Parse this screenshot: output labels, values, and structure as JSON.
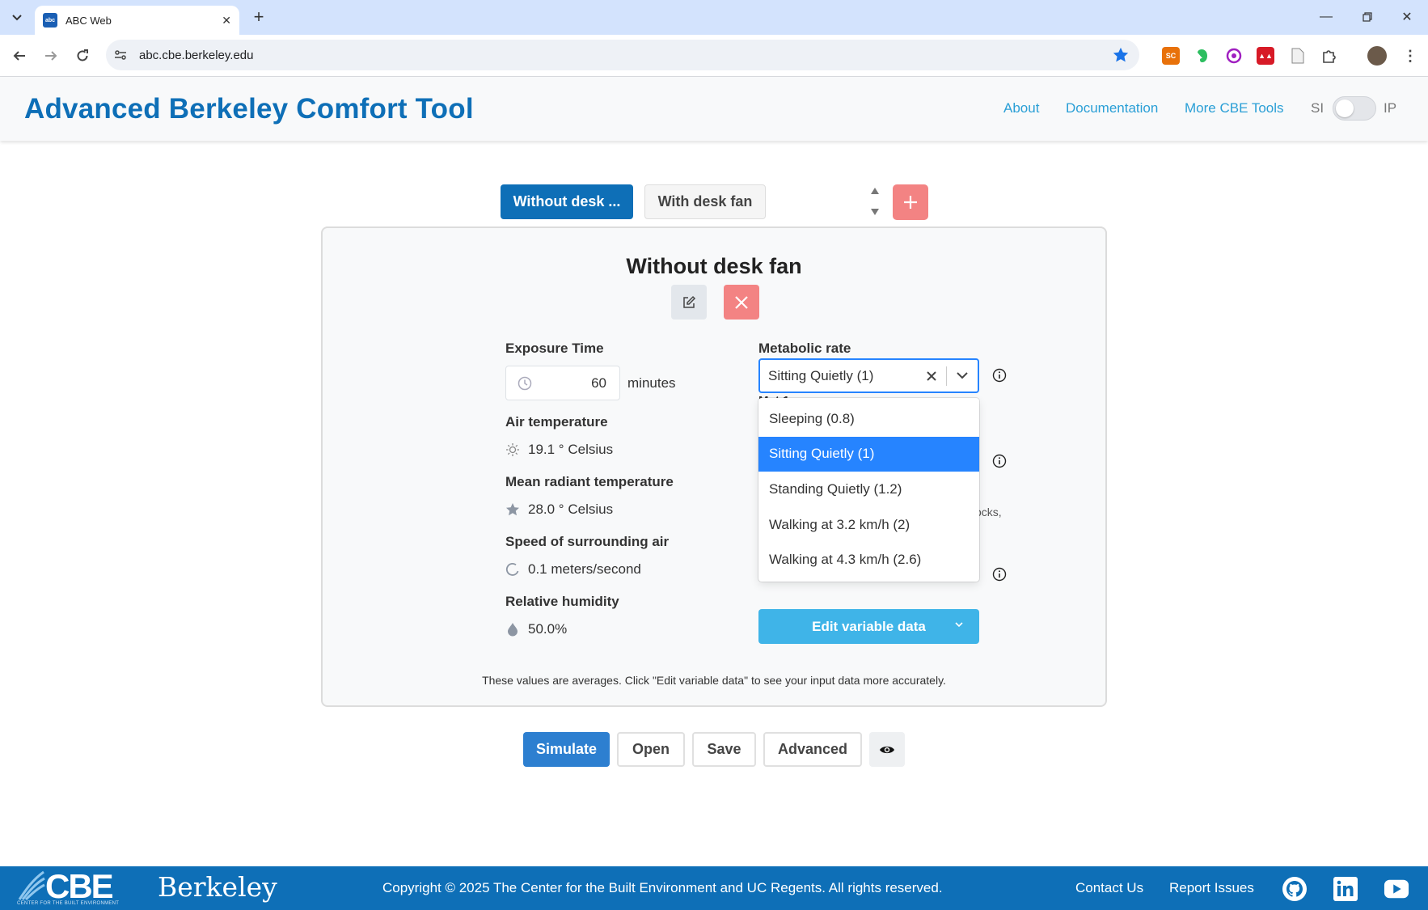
{
  "browser": {
    "tab_title": "ABC Web",
    "favicon_text": "abc",
    "url": "abc.cbe.berkeley.edu"
  },
  "header": {
    "title": "Advanced Berkeley Comfort Tool",
    "nav": [
      "About",
      "Documentation",
      "More CBE Tools"
    ],
    "unit_si": "SI",
    "unit_ip": "IP"
  },
  "scenarios": {
    "tabs": [
      "Without desk ...",
      "With desk fan"
    ]
  },
  "card": {
    "title": "Without desk fan",
    "exposure_label": "Exposure Time",
    "exposure_value": "60",
    "exposure_unit": "minutes",
    "air_temp_label": "Air temperature",
    "air_temp_value": "19.1 ° Celsius",
    "mrt_label": "Mean radiant temperature",
    "mrt_value": "28.0 ° Celsius",
    "air_speed_label": "Speed of surrounding air",
    "air_speed_value": "0.1 meters/second",
    "rh_label": "Relative humidity",
    "rh_value": "50.0%",
    "met_label": "Metabolic rate",
    "met_selected": "Sitting Quietly (1)",
    "met_options": [
      "Sleeping (0.8)",
      "Sitting Quietly (1)",
      "Standing Quietly (1.2)",
      "Walking at 3.2 km/h (2)",
      "Walking at 4.3 km/h (2.6)"
    ],
    "peek_label": "Met 1",
    "socks_fragment": "socks,",
    "edit_var_label": "Edit variable data",
    "note": "These values are averages. Click \"Edit variable data\" to see your input data more accurately."
  },
  "actions": [
    "Simulate",
    "Open",
    "Save",
    "Advanced"
  ],
  "footer": {
    "cbe": "CBE",
    "cbe_sub": "CENTER FOR THE BUILT ENVIRONMENT",
    "berkeley": "Berkeley",
    "copyright": "Copyright © 2025 The Center for the Built Environment and UC Regents. All rights reserved.",
    "links": [
      "Contact Us",
      "Report Issues"
    ]
  },
  "colors": {
    "brand_blue": "#0e6fb7",
    "link_blue": "#2a9fd6",
    "danger_pink": "#f38383",
    "select_blue": "#2684ff",
    "edit_var_blue": "#3fb4e8"
  },
  "icons": [
    "search-tune-icon",
    "star-icon",
    "clock-icon",
    "sun-icon",
    "star-fill-icon",
    "spinner-icon",
    "droplet-icon",
    "info-icon",
    "pencil-icon",
    "close-icon",
    "plus-icon",
    "eye-icon",
    "github-icon",
    "linkedin-icon",
    "youtube-icon"
  ]
}
